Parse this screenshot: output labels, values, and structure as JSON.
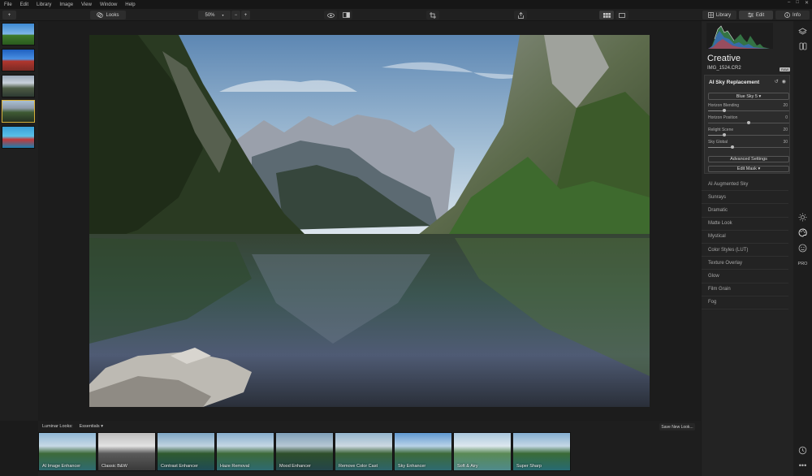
{
  "menu": [
    "File",
    "Edit",
    "Library",
    "Image",
    "View",
    "Window",
    "Help"
  ],
  "window_controls": [
    "–",
    "□",
    "✕"
  ],
  "toolbar": {
    "add_label": "+",
    "looks_label": "Looks",
    "zoom_value": "50%",
    "zoom_out": "−",
    "zoom_in": "+",
    "library_tab": "Library",
    "edit_tab": "Edit",
    "info_tab": "Info"
  },
  "panel": {
    "title": "Creative",
    "filename": "IMG_1524.CR2",
    "badge": "RAW",
    "tool_title": "AI Sky Replacement",
    "sky_select": "Blue Sky 5 ▾",
    "sliders": [
      {
        "label": "Horizon Blending",
        "value": "20",
        "level": 0.2
      },
      {
        "label": "Horizon Position",
        "value": "0",
        "level": 0.5
      },
      {
        "label": "Relight Scene",
        "value": "20",
        "level": 0.2
      },
      {
        "label": "Sky Global",
        "value": "30",
        "level": 0.3
      }
    ],
    "advanced_label": "Advanced Settings",
    "mask_label": "Edit Mask ▾",
    "tools": [
      "AI Augmented Sky",
      "Sunrays",
      "Dramatic",
      "Matte Look",
      "Mystical",
      "Color Styles (LUT)",
      "Texture Overlay",
      "Glow",
      "Film Grain",
      "Fog"
    ]
  },
  "rail_icons": [
    "layers-icon",
    "compare-icon",
    "sun-icon",
    "palette-icon",
    "smile-icon",
    "pro-icon",
    "history-icon",
    "more-icon"
  ],
  "rail_pro_label": "PRO",
  "looks": {
    "header": "Luminar Looks:",
    "category": "Essentials ▾",
    "save_label": "Save New Look...",
    "items": [
      "AI Image Enhancer",
      "Classic B&W",
      "Contrast Enhancer",
      "Haze Removal",
      "Mood Enhancer",
      "Remove Color Cast",
      "Sky Enhancer",
      "Soft & Airy",
      "Super Sharp"
    ]
  },
  "colors": {
    "accent": "#d6b03a",
    "bg": "#1b1b1b",
    "panel": "#232323"
  }
}
